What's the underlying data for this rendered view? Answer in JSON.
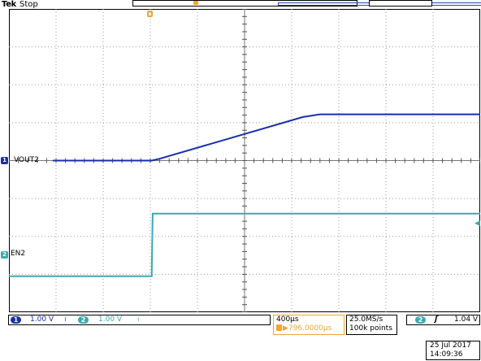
{
  "header": {
    "brand": "Tek",
    "state": "Stop"
  },
  "channels": [
    {
      "id": "1",
      "label": "VOUT2",
      "scale": "1.00 V",
      "bandwidth": "≀",
      "color": "#1a2ea8"
    },
    {
      "id": "2",
      "label": "EN2",
      "scale": "1.00 V",
      "bandwidth": "≀",
      "color": "#3ba9b0"
    }
  ],
  "horizontal": {
    "timebase": "400µs",
    "trigger_delay": "▶796.0000µs"
  },
  "acquisition": {
    "sample_rate": "25.0MS/s",
    "record_length": "100k points"
  },
  "trigger": {
    "source": "2",
    "slope": "ʃ",
    "level": "1.04 V",
    "marker_icon": "trigger-position-icon"
  },
  "timestamp": {
    "date": "25 Jul  2017",
    "time": "14:09:36"
  },
  "colors": {
    "ch1": "#1a2ea8",
    "ch2": "#3ba9b0",
    "trigger": "#f2a531"
  },
  "chart_data": {
    "type": "line",
    "x_unit": "div",
    "y_unit": "div",
    "xlim": [
      0,
      10
    ],
    "ylim": [
      -4,
      4
    ],
    "grid": true,
    "series": [
      {
        "name": "VOUT2",
        "x": [
          0.93,
          3.03,
          3.2,
          6.24,
          6.6,
          10.0
        ],
        "y": [
          0.0,
          0.0,
          0.05,
          1.15,
          1.22,
          1.22
        ]
      },
      {
        "name": "EN2",
        "x": [
          0.0,
          3.03,
          3.05,
          10.0
        ],
        "y": [
          -3.05,
          -3.05,
          -1.4,
          -1.4
        ]
      }
    ]
  }
}
